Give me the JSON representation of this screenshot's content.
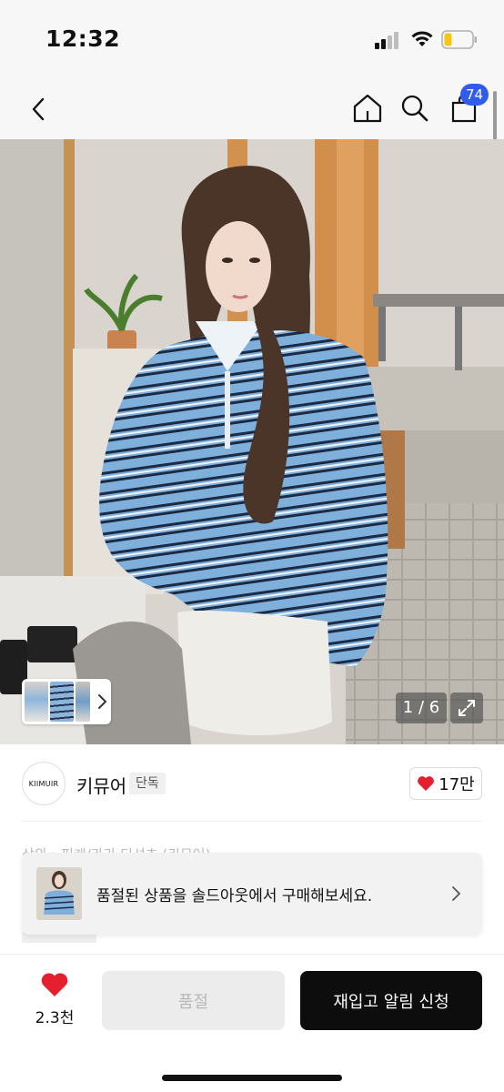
{
  "status_bar": {
    "time": "12:32"
  },
  "header": {
    "back_icon": "chevron-left-icon",
    "home_icon": "home-icon",
    "search_icon": "search-icon",
    "cart_icon": "shopping-bag-icon",
    "cart_count": "74",
    "badge_color": "#2f5dea"
  },
  "product_image": {
    "counter": "1 / 6",
    "description_icon": "expand-icon"
  },
  "brand": {
    "logo_text": "KIIMUIR",
    "name": "키뮤어",
    "badge": "단독"
  },
  "like": {
    "count": "17만",
    "icon": "heart-icon",
    "color": "#e5202e"
  },
  "breadcrumb_peek": "상의 › 피케/카라 티셔츠 (키뮤어)",
  "soldout_banner": {
    "text": "품절된 상품을 솔드아웃에서 구매해보세요.",
    "arrow_icon": "chevron-right-icon"
  },
  "bottom_bar": {
    "wish_count": "2.3천",
    "soldout_label": "품절",
    "restock_label": "재입고 알림 신청"
  }
}
